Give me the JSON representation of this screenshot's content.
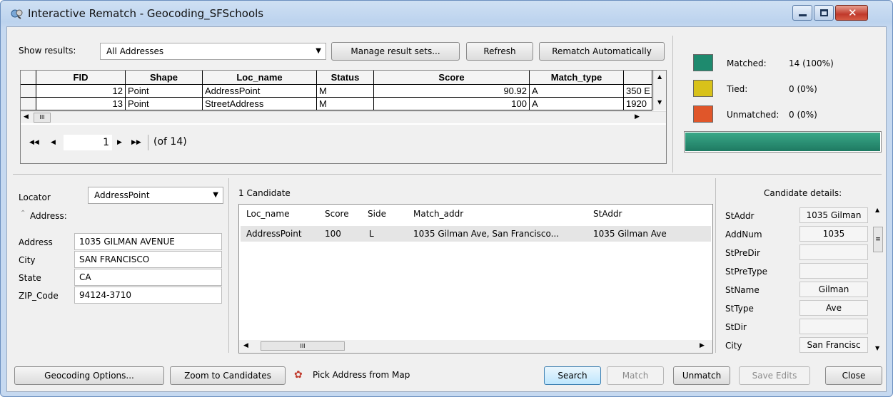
{
  "window": {
    "title": "Interactive Rematch - Geocoding_SFSchools"
  },
  "toolbar": {
    "show_results_label": "Show results:",
    "show_results_value": "All Addresses",
    "manage_label": "Manage result sets...",
    "refresh_label": "Refresh",
    "rematch_auto_label": "Rematch Automatically"
  },
  "results_grid": {
    "columns": [
      "FID",
      "Shape",
      "Loc_name",
      "Status",
      "Score",
      "Match_type",
      ""
    ],
    "rows": [
      [
        "12",
        "Point",
        "AddressPoint",
        "M",
        "90.92",
        "A",
        "350 E"
      ],
      [
        "13",
        "Point",
        "StreetAddress",
        "M",
        "100",
        "A",
        "1920"
      ]
    ],
    "scroll_thumb": "III"
  },
  "pager": {
    "current": "1",
    "total_text": "(of 14)"
  },
  "stats": {
    "matched_label": "Matched:",
    "matched_value": "14 (100%)",
    "tied_label": "Tied:",
    "tied_value": "0 (0%)",
    "unmatched_label": "Unmatched:",
    "unmatched_value": "0 (0%)",
    "matched_color": "#1e8a6e",
    "tied_color": "#d8c21a",
    "unmatched_color": "#e0562a",
    "progress_fraction": 1.0
  },
  "locator": {
    "label": "Locator",
    "value": "AddressPoint"
  },
  "address": {
    "section_label": "Address:",
    "fields": [
      {
        "label": "Address",
        "value": "1035 GILMAN AVENUE"
      },
      {
        "label": "City",
        "value": "SAN FRANCISCO"
      },
      {
        "label": "State",
        "value": "CA"
      },
      {
        "label": "ZIP_Code",
        "value": "94124-3710"
      }
    ]
  },
  "candidates": {
    "count_label": "1 Candidate",
    "columns": [
      "Loc_name",
      "Score",
      "Side",
      "Match_addr",
      "StAddr"
    ],
    "rows": [
      [
        "AddressPoint",
        "100",
        "L",
        "1035 Gilman Ave, San Francisco...",
        "1035 Gilman Ave"
      ]
    ],
    "scroll_thumb": "III"
  },
  "details": {
    "title": "Candidate details:",
    "items": [
      {
        "label": "StAddr",
        "value": "1035 Gilman"
      },
      {
        "label": "AddNum",
        "value": "1035"
      },
      {
        "label": "StPreDir",
        "value": ""
      },
      {
        "label": "StPreType",
        "value": ""
      },
      {
        "label": "StName",
        "value": "Gilman"
      },
      {
        "label": "StType",
        "value": "Ave"
      },
      {
        "label": "StDir",
        "value": ""
      },
      {
        "label": "City",
        "value": "San Francisc"
      }
    ]
  },
  "bottom": {
    "geocoding_options": "Geocoding Options...",
    "zoom_candidates": "Zoom to Candidates",
    "pick_address": "Pick Address from Map",
    "search": "Search",
    "match": "Match",
    "unmatch": "Unmatch",
    "save_edits": "Save Edits",
    "close": "Close"
  }
}
